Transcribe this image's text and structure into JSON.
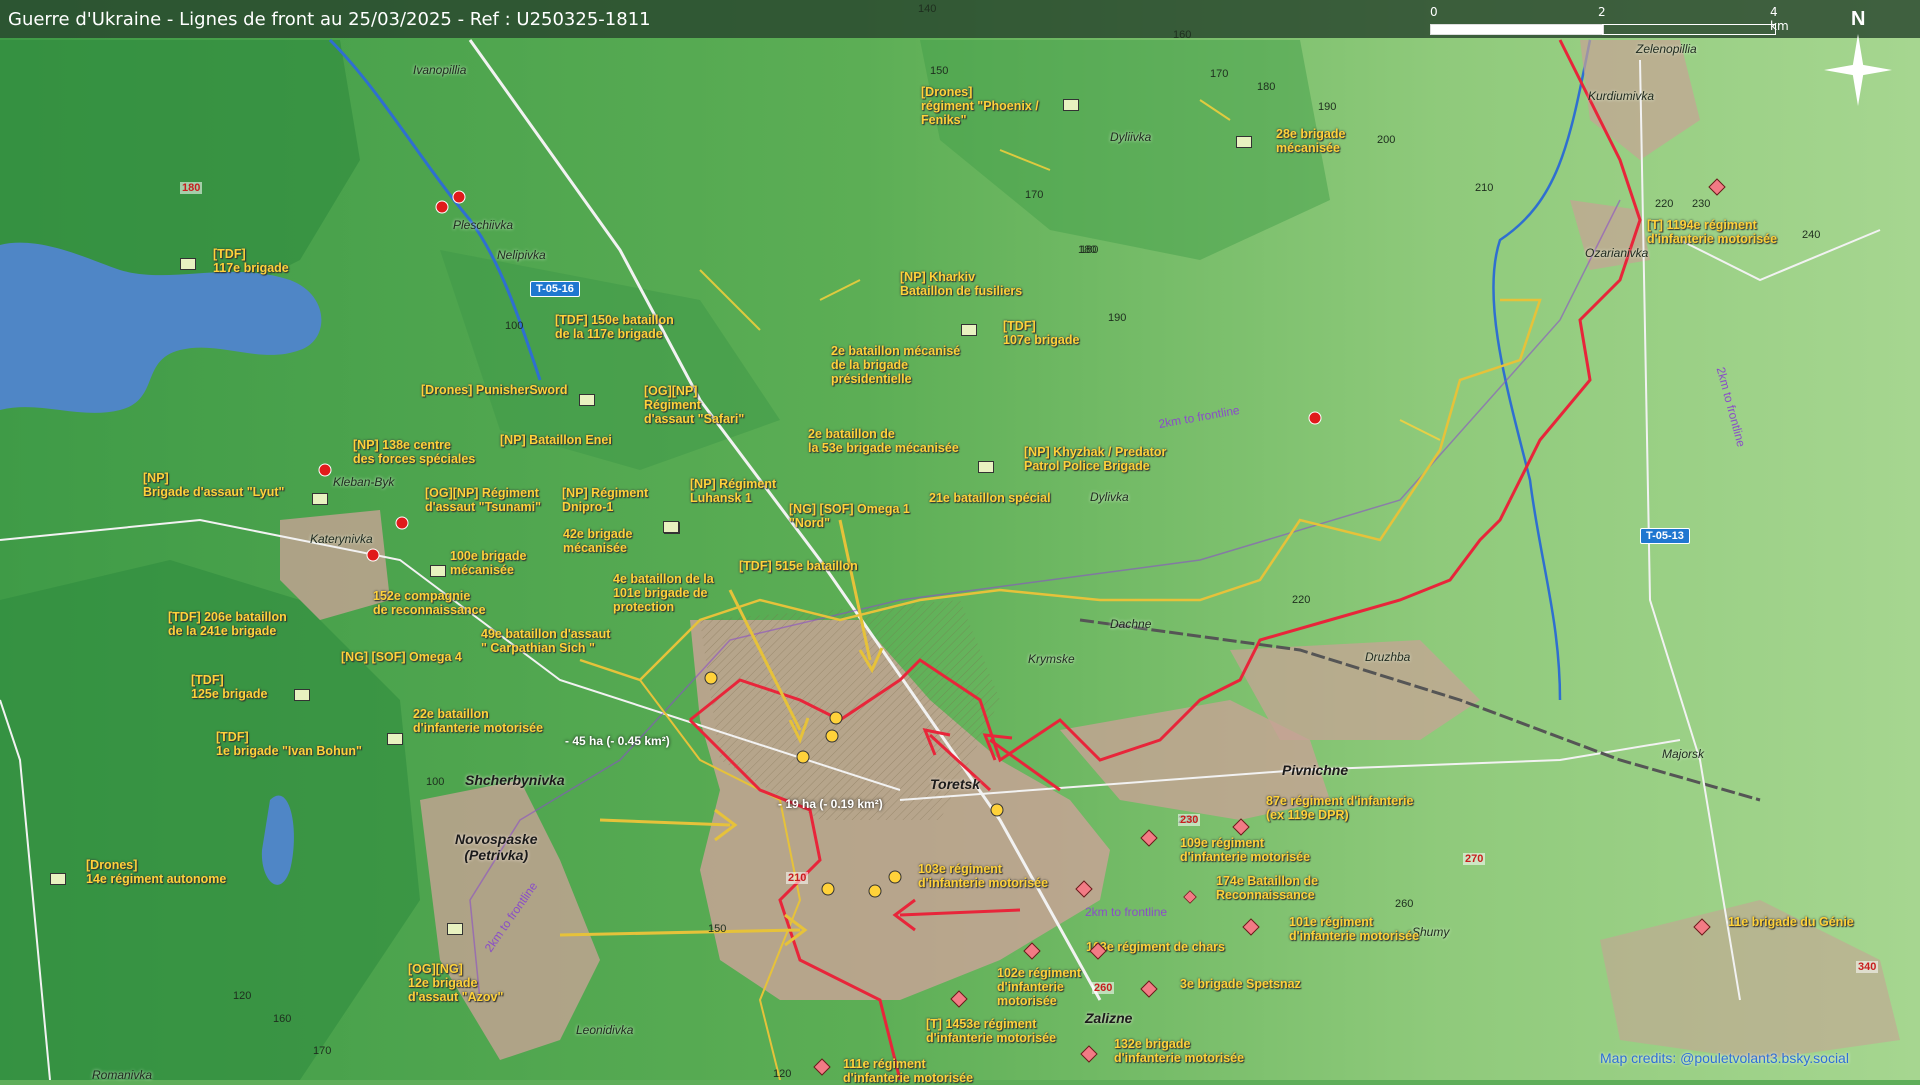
{
  "title": "Guerre d'Ukraine - Lignes de front au 25/03/2025 - Ref : U250325-1811",
  "scale": {
    "labels": [
      "0",
      "2",
      "4 km"
    ]
  },
  "compass": "N",
  "road_labels": [
    "T-05-16",
    "T-05-13"
  ],
  "frontline_labels": [
    "2km to frontline",
    "2km to frontline",
    "2km to frontline",
    "2km to frontline"
  ],
  "places": [
    "Ivanopillia",
    "Pleschiivka",
    "Nelipivka",
    "Kleban-Byk",
    "Katerynivka",
    "Dyliivka",
    "Dylivka",
    "Zelenopillia",
    "Kurdiumivka",
    "Ozarianivka",
    "Dachne",
    "Krymske",
    "Druzhba",
    "Majorsk",
    "Shumy",
    "Leonidivka",
    "Romanivka"
  ],
  "towns": [
    "Shcherbynivka",
    "Novospaske\n(Petrivka)",
    "Toretsk",
    "Pivnichne",
    "Zalizne"
  ],
  "areas": [
    "- 45 ha (- 0.45 km²)",
    "- 19 ha (- 0.19 km²)"
  ],
  "elevations": [
    "140",
    "150",
    "160",
    "170",
    "180",
    "190",
    "200",
    "180",
    "170",
    "210",
    "220",
    "230",
    "240",
    "180",
    "190",
    "100",
    "100",
    "220",
    "230",
    "260",
    "150",
    "120",
    "160",
    "170",
    "120"
  ],
  "elevations_red": [
    "180",
    "210",
    "270",
    "340",
    "260",
    "230"
  ],
  "ukr_units": [
    "[TDF]\n117e brigade",
    "[TDF] 150e bataillon\nde la 117e brigade",
    "[Drones] PunisherSword",
    "[NP] 138e centre\ndes forces spéciales",
    "[NP]\nBrigade d'assaut \"Lyut\"",
    "[NP] Bataillon Enei",
    "[OG][NP] Régiment\nd'assaut \"Tsunami\"",
    "[NP] Régiment\nDnipro-1",
    "[OG][NP]\nRégiment\nd'assaut \"Safari\"",
    "[NP] Régiment\nLuhansk 1",
    "100e brigade\nmécanisée",
    "42e brigade\nmécanisée",
    "152e compagnie\nde reconnaissance",
    "4e bataillon de la\n101e brigade de\nprotection",
    "[TDF] 206e bataillon\nde la 241e brigade",
    "49e bataillon d'assaut\n\" Carpathian Sich \"",
    "[NG] [SOF] Omega 4",
    "[TDF]\n125e brigade",
    "22e bataillon\nd'infanterie motorisée",
    "[TDF]\n1e brigade \"Ivan Bohun\"",
    "[Drones]\n14e régiment autonome",
    "[OG][NG]\n12e brigade\nd'assaut \"Azov\"",
    "[Drones]\nrégiment \"Phoenix /\nFeniks\"",
    "28e brigade\nmécanisée",
    "[NP] Kharkiv\nBataillon de fusiliers",
    "[TDF]\n107e brigade",
    "2e bataillon mécanisé\nde la brigade\nprésidentielle",
    "2e bataillon de\nla 53e brigade mécanisée",
    "[NP] Khyzhak / Predator\nPatrol Police Brigade",
    "21e bataillon spécial",
    "[NG] [SOF] Omega 1\n\"Nord\"",
    "[TDF] 515e bataillon"
  ],
  "rus_units": [
    "[T] 1194e régiment\nd'infanterie motorisée",
    "87e régiment d'infanterie\n(ex 119e DPR)",
    "109e régiment\nd'infanterie motorisée",
    "174e Bataillon de\nReconnaissance",
    "103e régiment\nd'infanterie motorisée",
    "101e régiment\nd'infanterie motorisée",
    "163e régiment de chars",
    "102e régiment\nd'infanterie\nmotorisée",
    "3e brigade Spetsnaz",
    "[T] 1453e régiment\nd'infanterie motorisée",
    "132e brigade\nd'infanterie motorisée",
    "111e régiment\nd'infanterie motorisée",
    "11e brigade du Génie"
  ],
  "credits": "Map credits: @pouletvolant3.bsky.social",
  "colors": {
    "ukraine": "#ffd23a",
    "russia": "#e8253a",
    "water": "#4f86c6",
    "urban": "#c7a395"
  }
}
